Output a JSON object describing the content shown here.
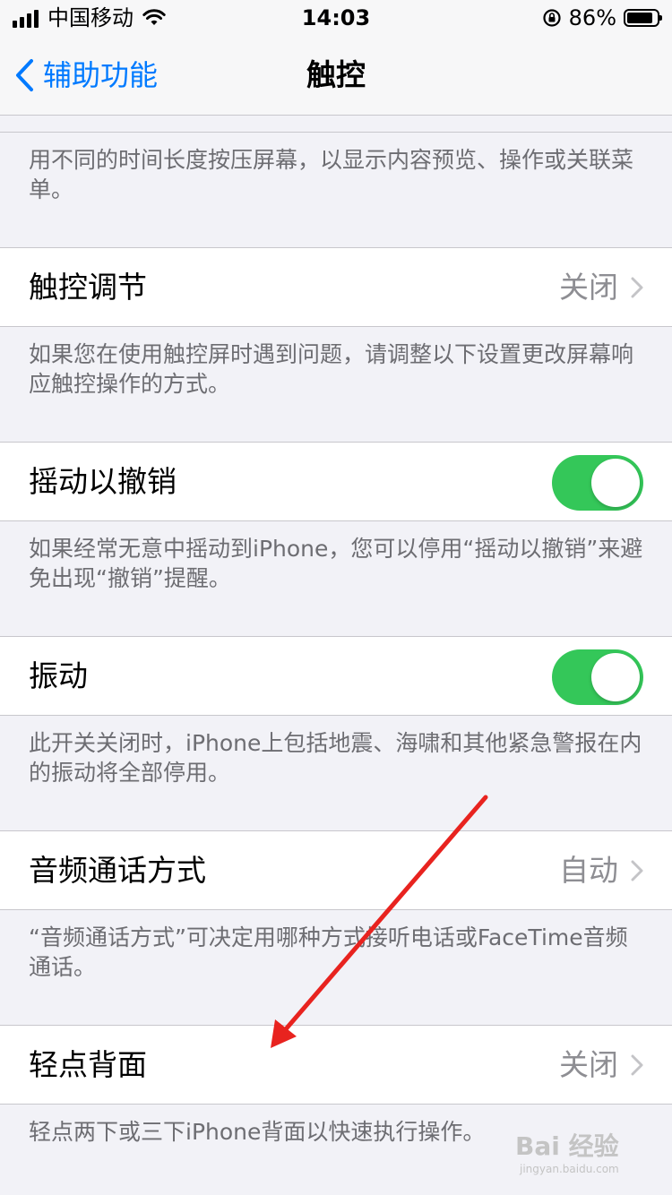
{
  "status_bar": {
    "carrier": "中国移动",
    "time": "14:03",
    "battery_percent": "86%",
    "icons": [
      "signal-icon",
      "wifi-icon",
      "rotation-lock-icon",
      "battery-icon"
    ]
  },
  "nav": {
    "back_label": "辅助功能",
    "title": "触控"
  },
  "sections": [
    {
      "footer": "用不同的时间长度按压屏幕，以显示内容预览、操作或关联菜单。"
    },
    {
      "row_label": "触控调节",
      "row_value": "关闭",
      "footer": "如果您在使用触控屏时遇到问题，请调整以下设置更改屏幕响应触控操作的方式。"
    },
    {
      "row_label": "摇动以撤销",
      "toggle": "on",
      "footer": "如果经常无意中摇动到iPhone，您可以停用“摇动以撤销”来避免出现“撤销”提醒。"
    },
    {
      "row_label": "振动",
      "toggle": "on",
      "footer": "此开关关闭时，iPhone上包括地震、海啸和其他紧急警报在内的振动将全部停用。"
    },
    {
      "row_label": "音频通话方式",
      "row_value": "自动",
      "footer": "“音频通话方式”可决定用哪种方式接听电话或FaceTime音频通话。"
    },
    {
      "row_label": "轻点背面",
      "row_value": "关闭",
      "footer": "轻点两下或三下iPhone背面以快速执行操作。"
    }
  ],
  "colors": {
    "accent": "#007aff",
    "toggle_on": "#34c759",
    "background": "#f2f2f7",
    "annotation_arrow": "#e8231f"
  },
  "watermark": {
    "brand": "Bai 经验",
    "url": "jingyan.baidu.com"
  }
}
